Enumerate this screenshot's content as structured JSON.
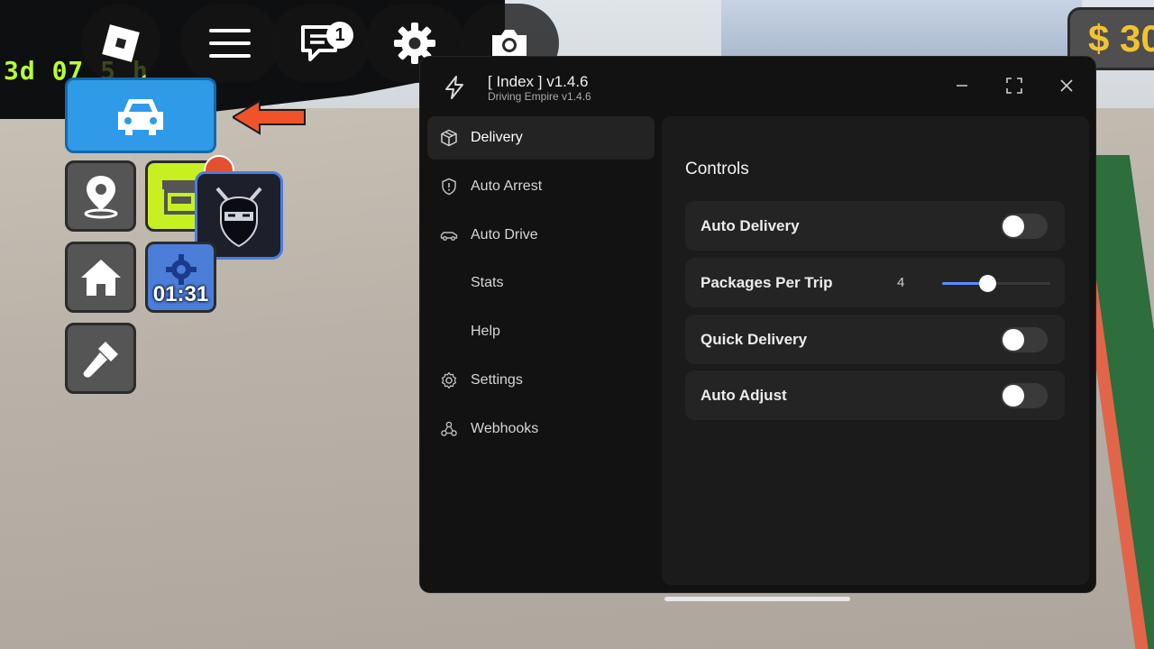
{
  "topbar": {
    "notification_count": "1"
  },
  "game": {
    "sign_text": "3d 07 5 h",
    "money_text": "$ 30",
    "timer": "01:31"
  },
  "window": {
    "title": "[ Index ] v1.4.6",
    "subtitle": "Driving Empire v1.4.6"
  },
  "sidebar": {
    "items": [
      {
        "label": "Delivery",
        "icon": "package-icon",
        "active": true
      },
      {
        "label": "Auto Arrest",
        "icon": "shield-icon",
        "active": false
      },
      {
        "label": "Auto Drive",
        "icon": "car-icon",
        "active": false
      },
      {
        "label": "Stats",
        "icon": "",
        "active": false
      },
      {
        "label": "Help",
        "icon": "",
        "active": false
      },
      {
        "label": "Settings",
        "icon": "gear-icon",
        "active": false
      },
      {
        "label": "Webhooks",
        "icon": "webhook-icon",
        "active": false
      }
    ]
  },
  "content": {
    "section_title": "Controls",
    "controls": [
      {
        "label": "Auto Delivery",
        "type": "toggle",
        "value": false
      },
      {
        "label": "Packages Per Trip",
        "type": "slider",
        "value": "4",
        "fraction": 0.42
      },
      {
        "label": "Quick Delivery",
        "type": "toggle",
        "value": false
      },
      {
        "label": "Auto Adjust",
        "type": "toggle",
        "value": false
      }
    ]
  },
  "colors": {
    "accent": "#5b8cff",
    "window_bg": "#121212",
    "panel_bg": "#1b1b1b",
    "row_bg": "#242424"
  }
}
